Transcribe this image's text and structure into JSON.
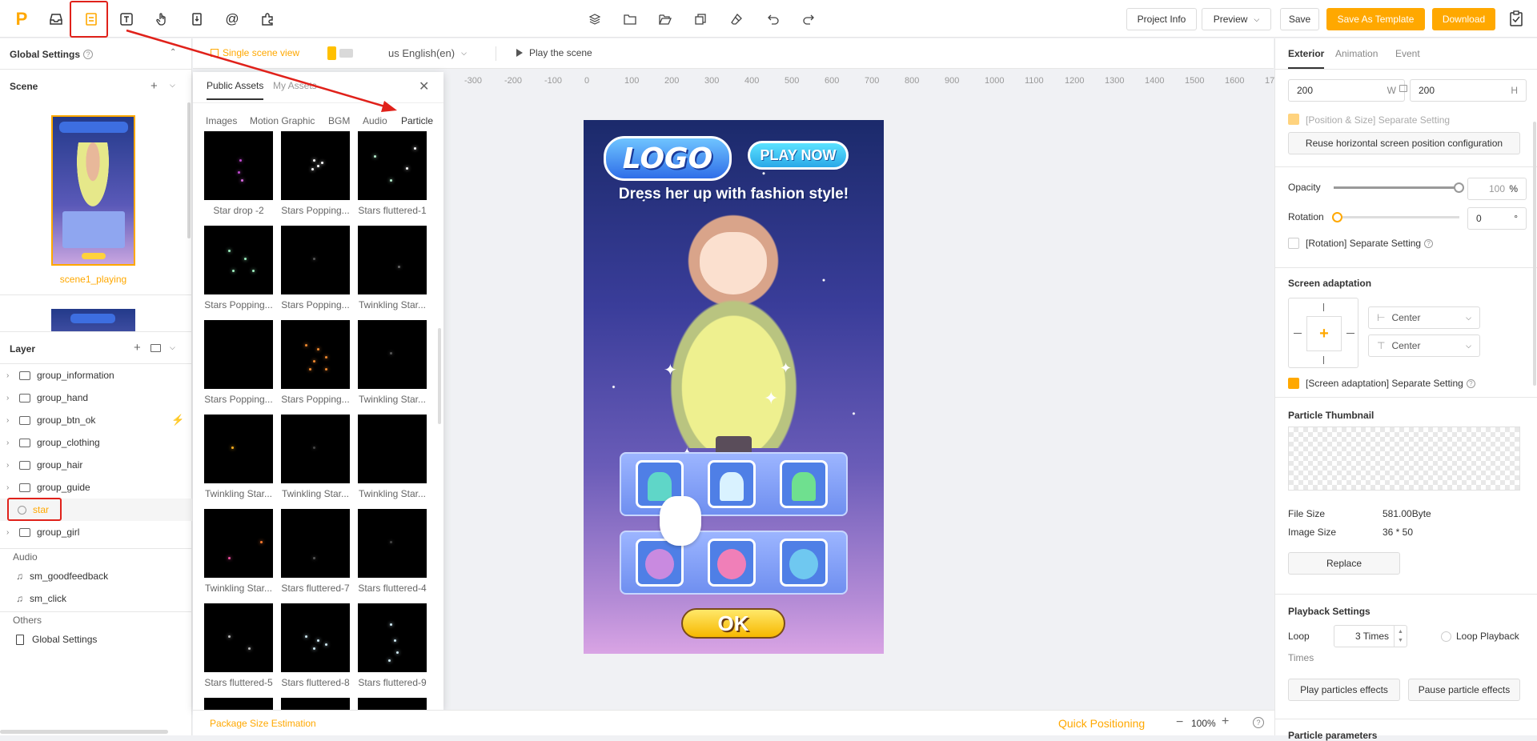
{
  "toolbar": {
    "project_info": "Project Info",
    "preview": "Preview",
    "save": "Save",
    "save_as_template": "Save As Template",
    "download": "Download"
  },
  "left": {
    "global_settings": "Global Settings",
    "scene_title": "Scene",
    "scene_name": "scene1_playing",
    "layer_title": "Layer",
    "layers": [
      "group_information",
      "group_hand",
      "group_btn_ok",
      "group_clothing",
      "group_hair",
      "group_guide",
      "star",
      "group_girl"
    ],
    "audio_title": "Audio",
    "audio_items": [
      "sm_goodfeedback",
      "sm_click"
    ],
    "others_title": "Others",
    "others_item": "Global Settings"
  },
  "canvas": {
    "single_scene_view": "Single scene view",
    "language": "us English(en)",
    "play_scene": "Play the scene",
    "ruler": [
      "-300",
      "-200",
      "-100",
      "0",
      "100",
      "200",
      "300",
      "400",
      "500",
      "600",
      "700",
      "800",
      "900",
      "1000",
      "1100",
      "1200",
      "1300",
      "1400",
      "1500",
      "1600",
      "17"
    ]
  },
  "assets": {
    "tab_public": "Public Assets",
    "tab_my": "My Assets",
    "categories": [
      "Images",
      "Motion Graphic",
      "BGM",
      "Audio",
      "Particle"
    ],
    "items": [
      "Star drop -2",
      "Stars Popping...",
      "Stars fluttered-1",
      "Stars Popping...",
      "Stars Popping...",
      "Twinkling Star...",
      "Stars Popping...",
      "Stars Popping...",
      "Twinkling Star...",
      "Twinkling Star...",
      "Twinkling Star...",
      "Twinkling Star...",
      "Twinkling Star...",
      "Stars fluttered-7",
      "Stars fluttered-4",
      "Stars fluttered-5",
      "Stars fluttered-8",
      "Stars fluttered-9"
    ]
  },
  "game": {
    "logo": "LOGO",
    "play_now": "PLAY NOW",
    "headline": "Dress her up with fashion style!",
    "ok": "OK"
  },
  "right": {
    "tabs": [
      "Exterior",
      "Animation",
      "Event"
    ],
    "width": "200",
    "w_label": "W",
    "height": "200",
    "h_label": "H",
    "pos_size_setting": "[Position & Size] Separate Setting",
    "reuse_btn": "Reuse horizontal screen position configuration",
    "opacity_label": "Opacity",
    "opacity_value": "100",
    "opacity_unit": "%",
    "opacity_level": 1.0,
    "rotation_label": "Rotation",
    "rotation_value": "0",
    "rotation_unit": "°",
    "rotation_setting": "[Rotation] Separate Setting",
    "screen_adapt_title": "Screen adaptation",
    "h_align": "Center",
    "v_align": "Center",
    "screen_adapt_setting": "[Screen adaptation] Separate Setting",
    "particle_thumb_title": "Particle Thumbnail",
    "file_size_label": "File Size",
    "file_size_value": "581.00Byte",
    "image_size_label": "Image Size",
    "image_size_value": "36 * 50",
    "replace_btn": "Replace",
    "playback_title": "Playback Settings",
    "loop_label": "Loop",
    "loop_value": "3 Times",
    "times_label": "Times",
    "loop_playback": "Loop Playback",
    "play_btn": "Play particles effects",
    "pause_btn": "Pause particle effects",
    "particle_params": "Particle parameters"
  },
  "bottom": {
    "package_size": "Package Size Estimation",
    "quick_positioning": "Quick Positioning",
    "zoom": "100%"
  },
  "colors": {
    "accent": "#ffa800",
    "annotation": "#e0211a"
  }
}
